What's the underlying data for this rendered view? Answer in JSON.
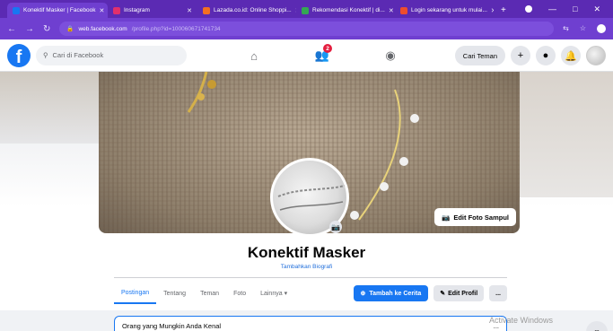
{
  "browser": {
    "tabs": [
      {
        "title": "Konektif Masker | Facebook",
        "color": "#1877f2",
        "active": true
      },
      {
        "title": "Instagram",
        "color": "#e1306c",
        "active": false
      },
      {
        "title": "Lazada.co.id: Online Shoppi...",
        "color": "#f36f21",
        "active": false
      },
      {
        "title": "Rekomendasi Konektif | di...",
        "color": "#34a853",
        "active": false
      },
      {
        "title": "Login sekarang untuk mulai...",
        "color": "#ee4d2d",
        "active": false
      }
    ],
    "url_domain": "web.facebook.com",
    "url_path": "/profile.php?id=100060671741734"
  },
  "fb_header": {
    "logo": "f",
    "search_placeholder": "Cari di Facebook",
    "friend_requests_badge": "2",
    "find_friends": "Cari Teman"
  },
  "profile": {
    "name": "Konektif Masker",
    "bio_link": "Tambahkan Biografi",
    "edit_cover": "Edit Foto Sampul"
  },
  "tabs": [
    "Postingan",
    "Tentang",
    "Teman",
    "Foto",
    "Lainnya"
  ],
  "actions": {
    "add_story": "Tambah ke Cerita",
    "edit_profile": "Edit Profil",
    "more": "..."
  },
  "suggestion": {
    "title": "Orang yang Mungkin Anda Kenal",
    "more": "..."
  },
  "watermark": "Activate Windows"
}
